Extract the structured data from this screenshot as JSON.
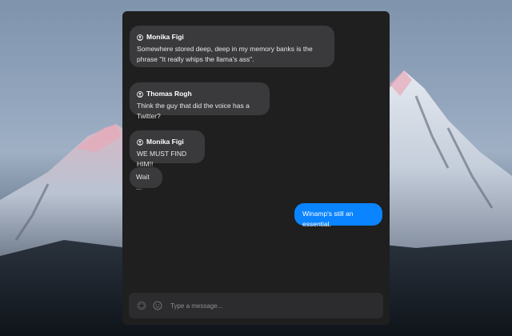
{
  "messages": [
    {
      "author": "Monika Figi",
      "text": "Somewhere stored deep, deep in my memory banks is the phrase \"It really whips the llama's ass\".",
      "direction": "incoming"
    },
    {
      "author": "Thomas Rogh",
      "text": "Think the guy that did the voice has a Twitter?",
      "direction": "incoming"
    },
    {
      "author": "Monika Figi",
      "text": "WE MUST FIND HIM!!",
      "direction": "incoming"
    },
    {
      "author": "",
      "text": "Wait ...",
      "direction": "incoming"
    },
    {
      "author": "",
      "text": "Winamp's still an essential.",
      "direction": "outgoing"
    }
  ],
  "composer": {
    "placeholder": "Type a message...",
    "value": ""
  },
  "icons": {
    "author": "user-circle-icon",
    "add": "plus-circle-icon",
    "emoji": "smiley-icon"
  },
  "colors": {
    "panel": "#1f1f1f",
    "incoming_bubble": "#3a3a3c",
    "outgoing_bubble": "#0a84ff",
    "composer": "#2c2c2e"
  }
}
